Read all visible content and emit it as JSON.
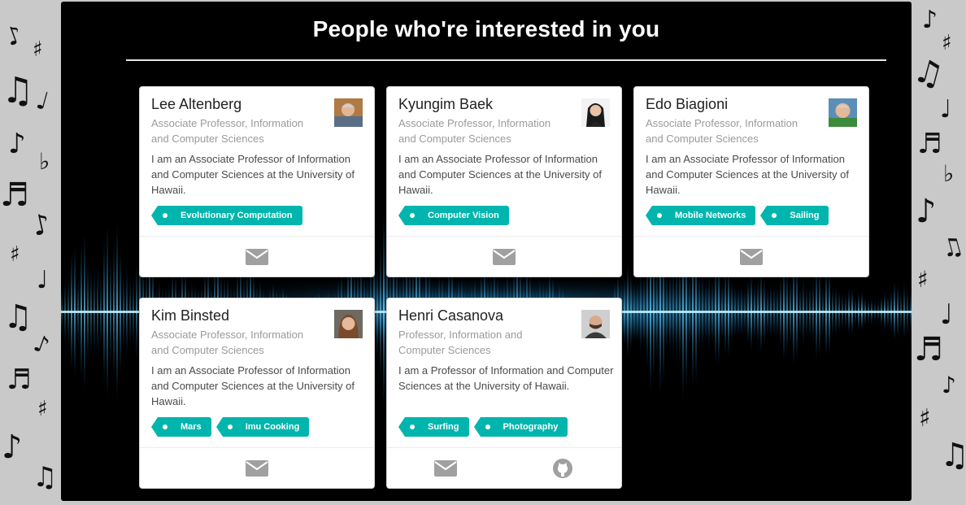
{
  "page": {
    "title": "People who're interested in you"
  },
  "colors": {
    "accent": "#00b5ad",
    "panel": "#000000",
    "icon": "#a0a0a0"
  },
  "profiles": [
    {
      "name": "Lee Altenberg",
      "position": "Associate Professor, Information and Computer Sciences",
      "bio": "I am an Associate Professor of Information and Computer Sciences at the University of Hawaii.",
      "interests": [
        "Evolutionary Computation"
      ],
      "actions": [
        "envelope-icon"
      ]
    },
    {
      "name": "Kyungim Baek",
      "position": "Associate Professor, Information and Computer Sciences",
      "bio": "I am an Associate Professor of Information and Computer Sciences at the University of Hawaii.",
      "interests": [
        "Computer Vision"
      ],
      "actions": [
        "envelope-icon"
      ]
    },
    {
      "name": "Edo Biagioni",
      "position": "Associate Professor, Information and Computer Sciences",
      "bio": "I am an Associate Professor of Information and Computer Sciences at the University of Hawaii.",
      "interests": [
        "Mobile Networks",
        "Sailing"
      ],
      "actions": [
        "envelope-icon"
      ]
    },
    {
      "name": "Kim Binsted",
      "position": "Associate Professor, Information and Computer Sciences",
      "bio": "I am an Associate Professor of Information and Computer Sciences at the University of Hawaii.",
      "interests": [
        "Mars",
        "Imu Cooking"
      ],
      "actions": [
        "envelope-icon"
      ]
    },
    {
      "name": "Henri Casanova",
      "position": "Professor, Information and Computer Sciences",
      "bio": "I am a Professor of Information and Computer Sciences at the University of Hawaii.",
      "interests": [
        "Surfing",
        "Photography"
      ],
      "actions": [
        "envelope-icon",
        "github-icon"
      ]
    }
  ]
}
